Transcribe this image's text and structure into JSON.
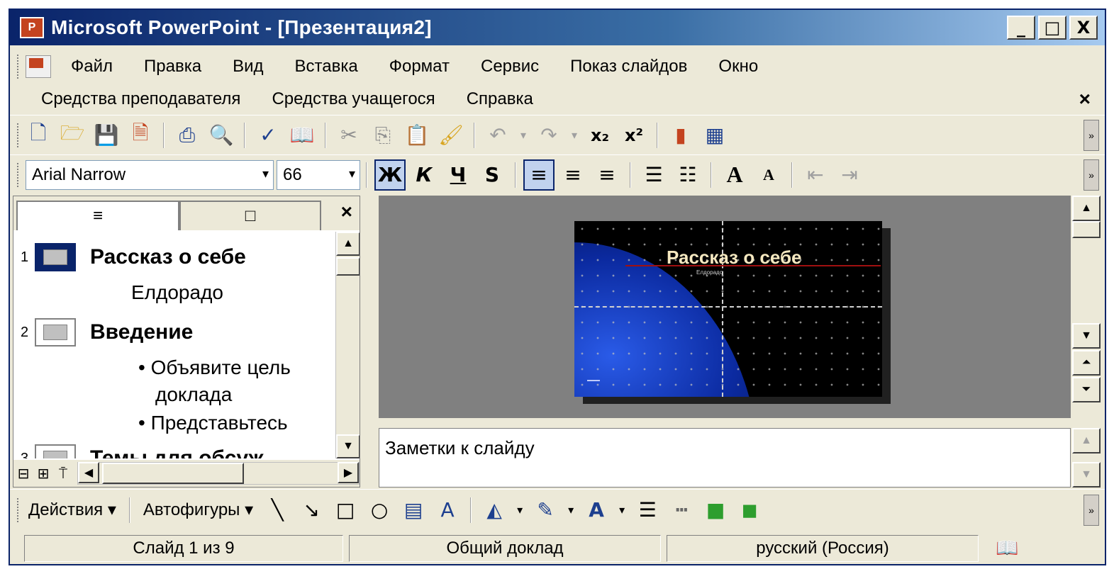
{
  "window": {
    "title": "Microsoft PowerPoint - [Презентация2]",
    "minimize": "_",
    "maximize": "□",
    "close": "X"
  },
  "menu": {
    "row1": [
      "Файл",
      "Правка",
      "Вид",
      "Вставка",
      "Формат",
      "Сервис",
      "Показ слайдов",
      "Окно"
    ],
    "row2": [
      "Средства преподавателя",
      "Средства учащегося",
      "Справка"
    ],
    "close": "×"
  },
  "formatting": {
    "font_name": "Arial Narrow",
    "font_size": "66",
    "bold": "Ж",
    "italic": "К",
    "underline": "Ч",
    "shadow": "S",
    "increase_font": "A",
    "decrease_font": "A"
  },
  "outline_pane": {
    "tab_outline_icon": "≡",
    "tab_slides_icon": "□",
    "close": "×",
    "slides": [
      {
        "number": "1",
        "title": "Рассказ о себе",
        "lines": [
          "Елдорадо"
        ]
      },
      {
        "number": "2",
        "title": "Введение",
        "lines": [
          "• Объявите цель",
          "доклада",
          "• Представьтесь"
        ]
      },
      {
        "number": "3",
        "title": "Темы для обсуж",
        "lines": []
      }
    ]
  },
  "slide": {
    "title": "Рассказ о себе",
    "subtitle": "Елдорадо"
  },
  "notes": {
    "placeholder": "Заметки к слайду"
  },
  "drawing_toolbar": {
    "actions": "Действия ▾",
    "autoshapes": "Автофигуры ▾"
  },
  "status": {
    "slide_counter": "Слайд 1 из 9",
    "design": "Общий доклад",
    "language": "русский (Россия)"
  },
  "colors": {
    "titlebar": "#0a246a",
    "chrome": "#ece9d8",
    "slide_blue": "#0b2aa0",
    "slide_title": "#f5e8c0"
  }
}
